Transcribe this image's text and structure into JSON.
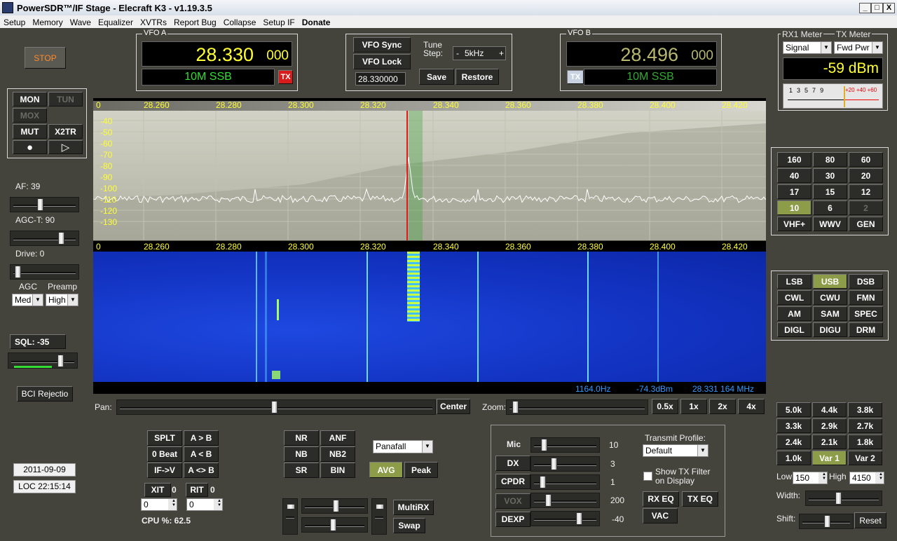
{
  "window": {
    "title": "PowerSDR™/IF Stage - Elecraft K3 - v1.19.3.5",
    "min": "_",
    "max": "□",
    "close": "X"
  },
  "menu": [
    "Setup",
    "Memory",
    "Wave",
    "Equalizer",
    "XVTRs",
    "Report Bug",
    "Collapse",
    "Setup IF",
    "Donate"
  ],
  "stop_label": "STOP",
  "vfo_a": {
    "title": "VFO A",
    "freq": "28.330",
    "freq_sub": "000",
    "mode": "10M SSB",
    "tx": "TX"
  },
  "vfo_b": {
    "title": "VFO B",
    "freq": "28.496",
    "freq_sub": "000",
    "mode": "10M SSB",
    "tx": "TX"
  },
  "vfo_mid": {
    "sync": "VFO Sync",
    "lock": "VFO Lock",
    "tune_step_label": "Tune Step:",
    "tune_step": "5kHz",
    "minus": "-",
    "plus": "+",
    "freq_input": "28.330000",
    "save": "Save",
    "restore": "Restore"
  },
  "meter": {
    "rx_title": "RX1 Meter",
    "tx_title": "TX Meter",
    "rx_select": "Signal",
    "tx_select": "Fwd Pwr",
    "reading": "-59 dBm",
    "scale_white": [
      "1",
      "3",
      "5",
      "7",
      "9"
    ],
    "scale_red": [
      "+20",
      "+40",
      "+60"
    ]
  },
  "mon_group": {
    "mon": "MON",
    "tun": "TUN",
    "mox": "MOX",
    "mut": "MUT",
    "x2tr": "X2TR",
    "rec": "●",
    "play": "▷"
  },
  "left": {
    "af": "AF:  39",
    "agct": "AGC-T:  90",
    "drive": "Drive:  0",
    "agc_label": "AGC",
    "preamp_label": "Preamp",
    "agc": "Med",
    "preamp": "High",
    "sql": "SQL:  -35",
    "bci": "BCI Rejectio",
    "date": "2011-09-09",
    "time": "LOC 22:15:14"
  },
  "spectrum": {
    "x_labels": [
      "0",
      "28.260",
      "28.280",
      "28.300",
      "28.320",
      "28.340",
      "28.360",
      "28.380",
      "28.400",
      "28.420"
    ],
    "y_labels": [
      "-40",
      "-50",
      "-60",
      "-70",
      "-80",
      "-90",
      "-100",
      "-110",
      "-120",
      "-130"
    ],
    "readout_hz": "1164.0Hz",
    "readout_dbm": "-74.3dBm",
    "readout_mhz": "28.331 164 MHz"
  },
  "pan_label": "Pan:",
  "center": "Center",
  "zoom_label": "Zoom:",
  "zoom_buttons": [
    "0.5x",
    "1x",
    "2x",
    "4x"
  ],
  "bands": [
    "160",
    "80",
    "60",
    "40",
    "30",
    "20",
    "17",
    "15",
    "12",
    "10",
    "6",
    "2",
    "VHF+",
    "WWV",
    "GEN"
  ],
  "modes": [
    "LSB",
    "USB",
    "DSB",
    "CWL",
    "CWU",
    "FMN",
    "AM",
    "SAM",
    "SPEC",
    "DIGL",
    "DIGU",
    "DRM"
  ],
  "filters": [
    "5.0k",
    "4.4k",
    "3.8k",
    "3.3k",
    "2.9k",
    "2.7k",
    "2.4k",
    "2.1k",
    "1.8k",
    "1.0k",
    "Var 1",
    "Var 2"
  ],
  "filter_controls": {
    "low_label": "Low",
    "low": "150",
    "high_label": "High",
    "high": "4150",
    "width_label": "Width:",
    "shift_label": "Shift:",
    "reset": "Reset"
  },
  "split_group": {
    "splt": "SPLT",
    "atob": "A > B",
    "zerobeat": "0 Beat",
    "btoa": "A < B",
    "ifv": "IF->V",
    "swap": "A <> B",
    "xit": "XIT",
    "xit_val": "0",
    "rit": "RIT",
    "rit_val": "0",
    "xit_spin": "0",
    "rit_spin": "0",
    "cpu": "CPU %:  62.5"
  },
  "dsp_group": {
    "nr": "NR",
    "anf": "ANF",
    "nb": "NB",
    "nb2": "NB2",
    "sr": "SR",
    "bin": "BIN",
    "display_mode": "Panafall",
    "avg": "AVG",
    "peak": "Peak",
    "multirx": "MultiRX",
    "swap": "Swap"
  },
  "tx_group": {
    "mic": "Mic",
    "mic_val": "10",
    "dx": "DX",
    "dx_val": "3",
    "cpdr": "CPDR",
    "cpdr_val": "1",
    "vox": "VOX",
    "vox_val": "200",
    "dexp": "DEXP",
    "dexp_val": "-40",
    "profile_label": "Transmit Profile:",
    "profile": "Default",
    "show_tx_filter": "Show TX Filter on Display",
    "rx_eq": "RX EQ",
    "tx_eq": "TX EQ",
    "vac": "VAC"
  },
  "colors": {
    "accent_on": "#8c9c48",
    "freq_a": "#ffff33",
    "freq_b": "#b8b870",
    "mode_text": "#33dd33",
    "readout": "#3399ff"
  }
}
